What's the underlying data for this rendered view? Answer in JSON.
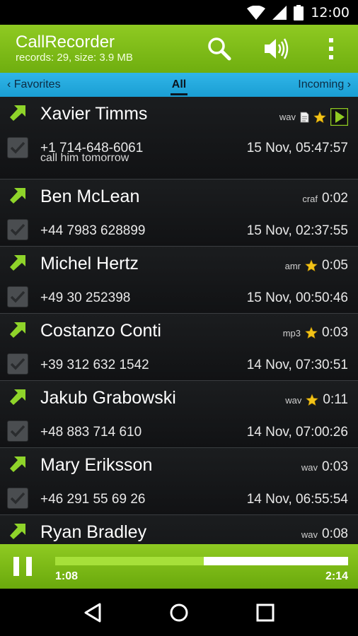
{
  "status": {
    "time": "12:00"
  },
  "app": {
    "title": "CallRecorder",
    "subtitle": "records: 29, size: 3.9 MB",
    "icons": [
      "search-icon",
      "speaker-icon",
      "overflow-menu-icon"
    ]
  },
  "tabs": {
    "left": "‹ Favorites",
    "center": "All",
    "right": "Incoming ›"
  },
  "records": [
    {
      "name": "Xavier Timms",
      "phone": "+1 714-648-6061",
      "date": "15 Nov, 05:47:57",
      "format": "wav",
      "duration": "",
      "note": "call him tomorrow",
      "has_note": true,
      "starred": true,
      "playing": true
    },
    {
      "name": "Ben McLean",
      "phone": "+44 7983 628899",
      "date": "15 Nov, 02:37:55",
      "format": "craf",
      "duration": "0:02",
      "note": "",
      "has_note": false,
      "starred": false,
      "playing": false
    },
    {
      "name": "Michel Hertz",
      "phone": "+49 30 252398",
      "date": "15 Nov, 00:50:46",
      "format": "amr",
      "duration": "0:05",
      "note": "",
      "has_note": false,
      "starred": true,
      "playing": false
    },
    {
      "name": "Costanzo Conti",
      "phone": "+39 312 632 1542",
      "date": "14 Nov, 07:30:51",
      "format": "mp3",
      "duration": "0:03",
      "note": "",
      "has_note": false,
      "starred": true,
      "playing": false
    },
    {
      "name": "Jakub Grabowski",
      "phone": "+48 883 714 610",
      "date": "14 Nov, 07:00:26",
      "format": "wav",
      "duration": "0:11",
      "note": "",
      "has_note": false,
      "starred": true,
      "playing": false
    },
    {
      "name": "Mary Eriksson",
      "phone": "+46 291 55 69 26",
      "date": "14 Nov, 06:55:54",
      "format": "wav",
      "duration": "0:03",
      "note": "",
      "has_note": false,
      "starred": false,
      "playing": false
    },
    {
      "name": "Ryan Bradley",
      "phone": "",
      "date": "",
      "format": "wav",
      "duration": "0:08",
      "note": "",
      "has_note": false,
      "starred": false,
      "playing": false
    }
  ],
  "player": {
    "elapsed": "1:08",
    "total": "2:14",
    "progress": 0.507
  },
  "colors": {
    "accent_green": "#8fca22",
    "tab_blue": "#1fa6dc",
    "star": "#f2c318",
    "arrow": "#8fd42a"
  }
}
